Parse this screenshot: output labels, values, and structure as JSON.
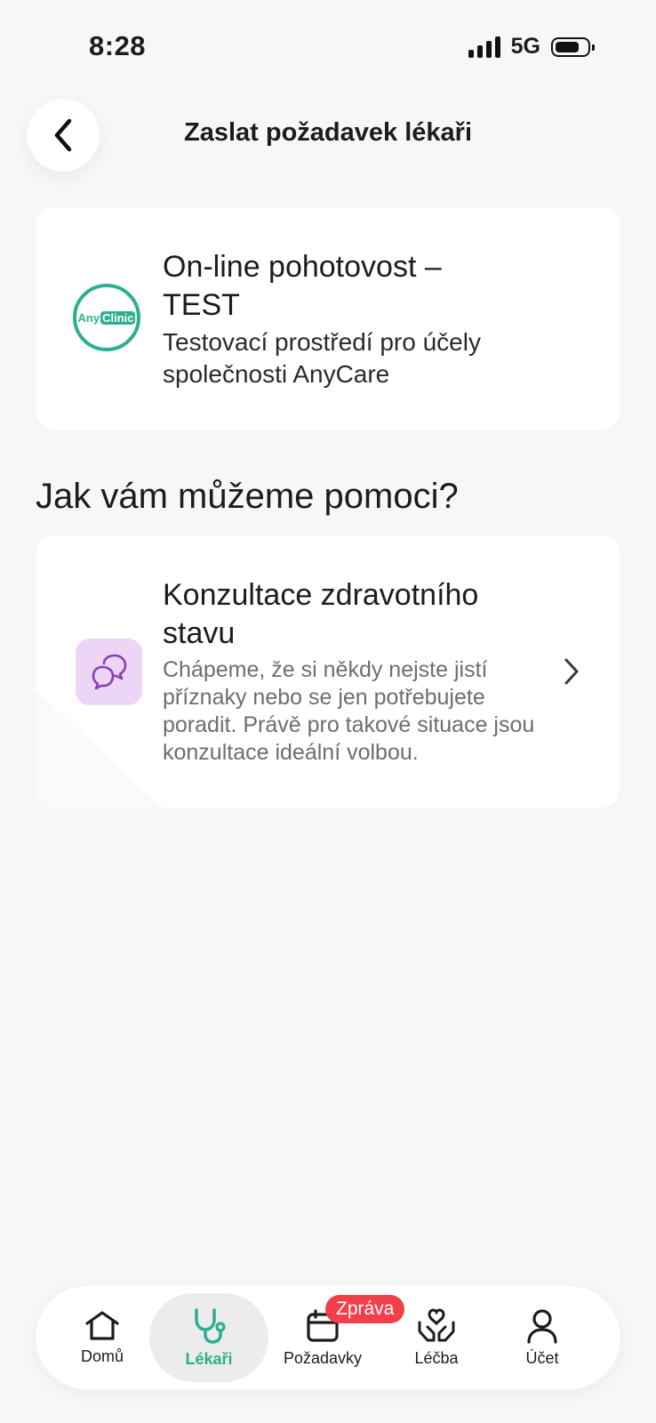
{
  "status_bar": {
    "time": "8:28",
    "network": "5G",
    "battery_level": 0.8
  },
  "header": {
    "title": "Zaslat požadavek lékaři"
  },
  "clinic": {
    "logo_any": "Any",
    "logo_clinic": "Clinic",
    "name": "On-line pohotovost – TEST",
    "description": "Testovací prostředí pro účely společnosti AnyCare"
  },
  "section": {
    "title": "Jak vám můžeme pomoci?"
  },
  "service": {
    "title": "Konzultace zdravotního stavu",
    "description": "Chápeme, že si někdy nejste jistí příznaky nebo se jen potřebujete poradit. Právě pro takové situace jsou konzultace ideální volbou."
  },
  "nav": {
    "items": [
      {
        "label": "Domů",
        "icon": "home-icon"
      },
      {
        "label": "Lékaři",
        "icon": "stethoscope-icon",
        "active": true
      },
      {
        "label": "Požadavky",
        "icon": "calendar-icon",
        "badge": "Zpráva"
      },
      {
        "label": "Léčba",
        "icon": "care-hands-icon"
      },
      {
        "label": "Účet",
        "icon": "user-icon"
      }
    ]
  },
  "colors": {
    "accent": "#2bb08f",
    "badge": "#f1404a",
    "service_icon_bg": "#edd5f5",
    "service_icon": "#8a3fb5"
  }
}
